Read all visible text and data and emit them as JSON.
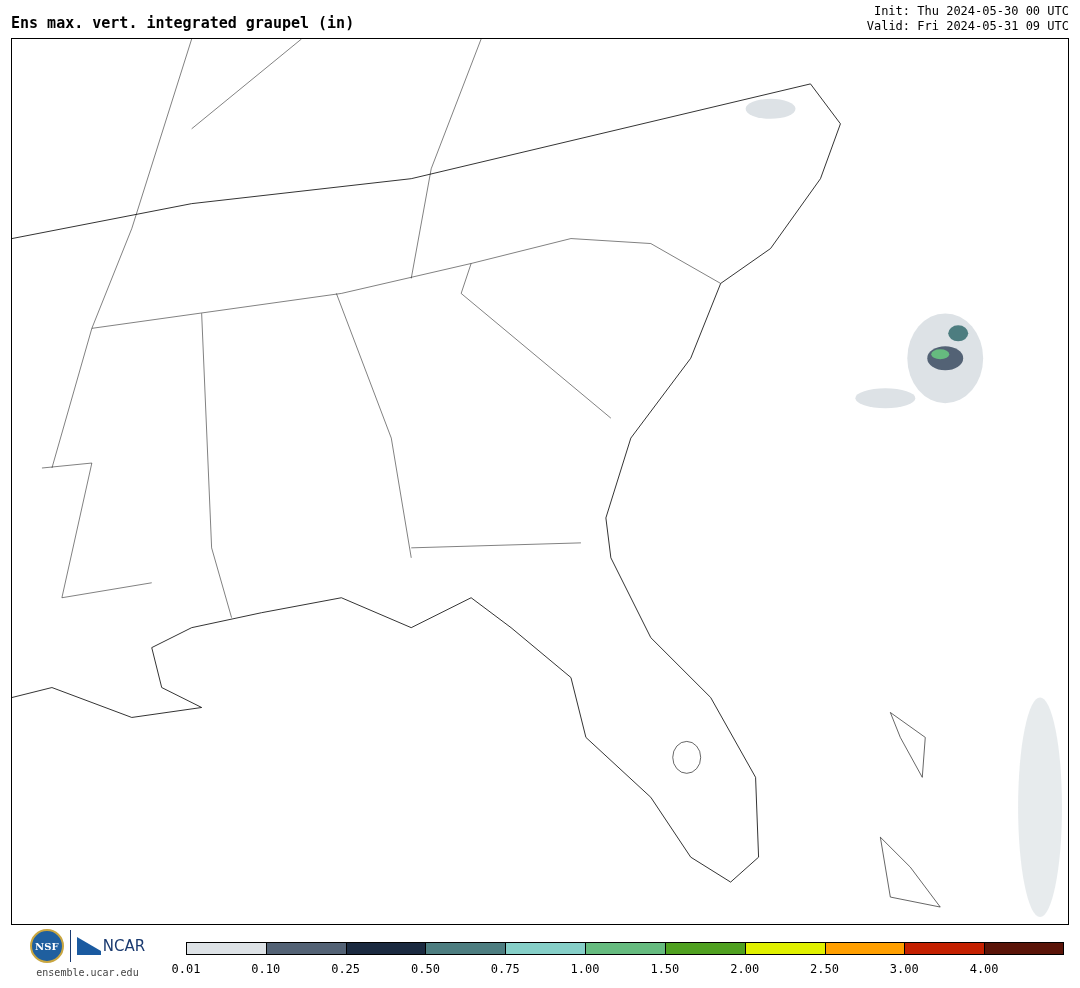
{
  "title": "Ens max. vert. integrated graupel (in)",
  "init": "Init: Thu 2024-05-30 00 UTC",
  "valid": "Valid: Fri 2024-05-31 09 UTC",
  "logos": {
    "nsf": "NSF",
    "ncar": "NCAR",
    "url": "ensemble.ucar.edu"
  },
  "colorbar": [
    {
      "label": "0.01",
      "color": "#dde2e6"
    },
    {
      "label": "0.10",
      "color": "#536275"
    },
    {
      "label": "0.25",
      "color": "#1b2a40"
    },
    {
      "label": "0.50",
      "color": "#4d7d80"
    },
    {
      "label": "0.75",
      "color": "#86cfc8"
    },
    {
      "label": "1.00",
      "color": "#66bb7f"
    },
    {
      "label": "1.50",
      "color": "#4fa020"
    },
    {
      "label": "2.00",
      "color": "#e0f000"
    },
    {
      "label": "2.50",
      "color": "#ff9f00"
    },
    {
      "label": "3.00",
      "color": "#c42000"
    },
    {
      "label": "4.00",
      "color": "#5a1408"
    }
  ]
}
